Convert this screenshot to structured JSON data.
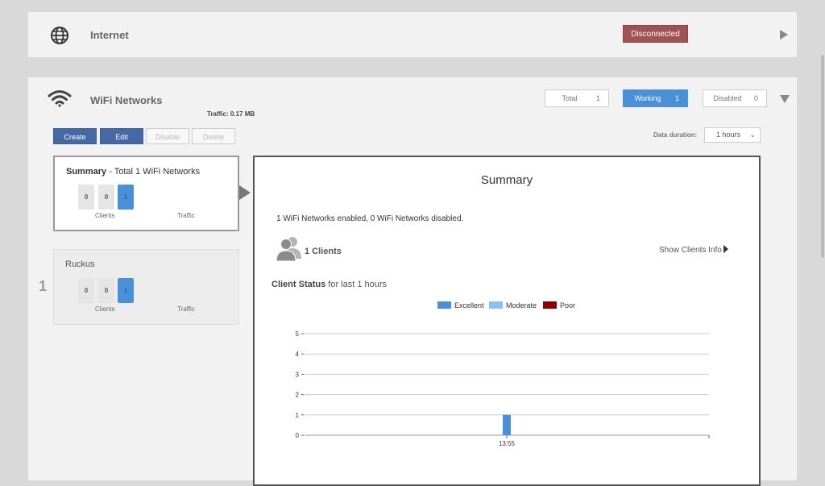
{
  "internet": {
    "title": "Internet",
    "status": "Disconnected",
    "icon": "globe-icon",
    "status_color": "#a05353"
  },
  "wifi": {
    "title": "WiFi Networks",
    "traffic": "Traffic: 0.17 MB",
    "icon": "wifi-icon",
    "stats": {
      "total_label": "Total",
      "total_value": "1",
      "working_label": "Working",
      "working_value": "1",
      "disabled_label": "Disabled",
      "disabled_value": "0"
    },
    "buttons": {
      "create": "Create",
      "edit": "Edit",
      "disable": "Disable",
      "delete": "Delete"
    },
    "duration": {
      "label": "Data duration:",
      "value": "1 hours"
    }
  },
  "cards": {
    "summary": {
      "title_bold": "Summary",
      "title_rest": " - Total 1 WiFi Networks",
      "counts": [
        "0",
        "0",
        "1"
      ],
      "clients_label": "Clients",
      "traffic_label": "Traffic"
    },
    "ruckus": {
      "index": "1",
      "title": "Ruckus",
      "counts": [
        "0",
        "0",
        "1"
      ],
      "clients_label": "Clients",
      "traffic_label": "Traffic"
    }
  },
  "summary_panel": {
    "heading": "Summary",
    "enabled_text": "1 WiFi Networks enabled, 0 WiFi Networks disabled.",
    "clients_count": "1 Clients",
    "show_clients": "Show Clients Info",
    "status_bold": "Client Status",
    "status_rest": " for last 1 hours",
    "legend": [
      {
        "name": "Excellent",
        "color": "#4a90d9"
      },
      {
        "name": "Moderate",
        "color": "#8fbef0"
      },
      {
        "name": "Poor",
        "color": "#8b0000"
      }
    ]
  },
  "chart_data": {
    "type": "bar",
    "title": "",
    "xlabel": "",
    "ylabel": "",
    "categories": [
      "13:55"
    ],
    "series": [
      {
        "name": "Excellent",
        "values": [
          1
        ]
      },
      {
        "name": "Moderate",
        "values": [
          0
        ]
      },
      {
        "name": "Poor",
        "values": [
          0
        ]
      }
    ],
    "yticks": [
      0,
      1,
      2,
      3,
      4,
      5
    ],
    "ylim": [
      0,
      5
    ],
    "grid": true
  }
}
